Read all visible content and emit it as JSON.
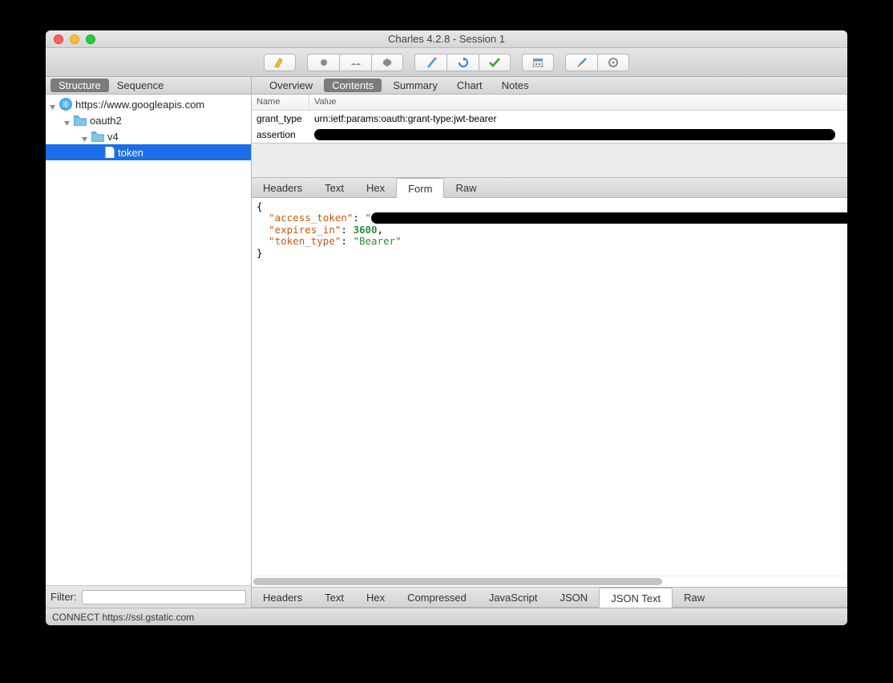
{
  "window": {
    "title": "Charles 4.2.8 - Session 1"
  },
  "toolbar_icons": [
    "broom",
    "record",
    "turtle",
    "stop",
    "pencil",
    "refresh",
    "check",
    "basket",
    "tools",
    "gear"
  ],
  "sidebar": {
    "tabs": [
      "Structure",
      "Sequence"
    ],
    "active_tab": "Structure",
    "tree": {
      "host": "https://www.googleapis.com",
      "children": [
        {
          "label": "oauth2",
          "children": [
            {
              "label": "v4",
              "children": [
                {
                  "label": "token",
                  "selected": true
                }
              ]
            }
          ]
        }
      ]
    },
    "filter_label": "Filter:",
    "filter_value": ""
  },
  "detail": {
    "tabs": [
      "Overview",
      "Contents",
      "Summary",
      "Chart",
      "Notes"
    ],
    "active_tab": "Contents",
    "request": {
      "columns": [
        "Name",
        "Value"
      ],
      "rows": [
        {
          "name": "grant_type",
          "value": "urn:ietf:params:oauth:grant-type:jwt-bearer"
        },
        {
          "name": "assertion",
          "value_redacted": true
        }
      ],
      "subtabs": [
        "Headers",
        "Text",
        "Hex",
        "Form",
        "Raw"
      ],
      "active_subtab": "Form"
    },
    "response": {
      "json_text": {
        "access_token": {
          "redacted": true
        },
        "expires_in": 3600,
        "token_type": "Bearer"
      },
      "subtabs": [
        "Headers",
        "Text",
        "Hex",
        "Compressed",
        "JavaScript",
        "JSON",
        "JSON Text",
        "Raw"
      ],
      "active_subtab": "JSON Text"
    }
  },
  "status": "CONNECT https://ssl.gstatic.com"
}
